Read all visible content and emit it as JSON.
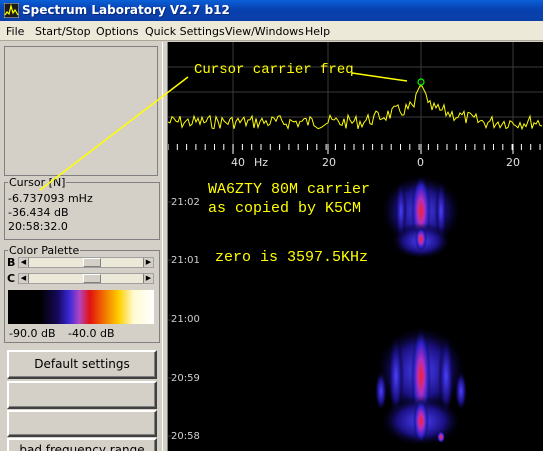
{
  "window": {
    "title": "Spectrum Laboratory V2.7 b12"
  },
  "menu": [
    "File",
    "Start/Stop",
    "Options",
    "Quick Settings",
    "View/Windows",
    "Help"
  ],
  "cursor_group": {
    "label": "Cursor [N]",
    "frequency": "-6.737093 mHz",
    "level": "-36.434 dB",
    "time": "20:58:32.0"
  },
  "color_palette": {
    "label": "Color Palette",
    "b_label": "B",
    "c_label": "C",
    "b_slider_fraction": 0.55,
    "c_slider_fraction": 0.55,
    "min_label": "-90.0 dB",
    "max_label": "-40.0 dB"
  },
  "buttons": {
    "default_settings": "Default settings",
    "blank_1": "",
    "blank_2": "",
    "partial": "bad frequency range"
  },
  "spectrum": {
    "annotation": "Cursor carrier freq",
    "freq_ticks": [
      "40",
      "Hz",
      "20",
      "0",
      "20"
    ]
  },
  "waterfall": {
    "annotation_lines": [
      "WA6ZTY 80M carrier",
      "as copied by K5CM"
    ],
    "zero_note": "zero is 3597.5KHz",
    "time_labels": [
      "21:02",
      "21:01",
      "21:00",
      "20:59",
      "20:58"
    ]
  },
  "colors": {
    "annotation": "#ffff00",
    "trace": "#ffff00",
    "marker": "#00ff00",
    "title_bar": "#0841b0"
  }
}
